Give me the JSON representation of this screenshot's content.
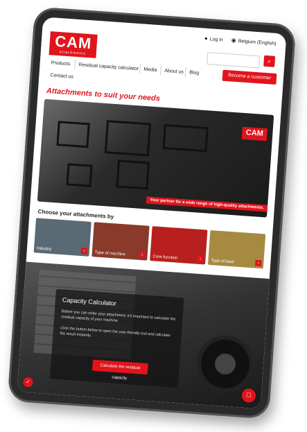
{
  "header": {
    "logo": "CAM",
    "logo_sub": "attachments",
    "login": "Log in",
    "region": "Belgium (English)",
    "search_placeholder": "",
    "nav": [
      "Products",
      "Residual capacity calculator",
      "Media",
      "About us",
      "Blog"
    ],
    "contact": "Contact us",
    "cta": "Become a customer"
  },
  "page_title": "Attachments to suit your needs",
  "hero": {
    "logo": "CAM",
    "tagline": "Your partner for a wide range of high-quality attachments."
  },
  "choose_title": "Choose your attachments by",
  "cards": [
    {
      "label": "Industry",
      "color": "#5a6a74"
    },
    {
      "label": "Type of machine",
      "color": "#8a3a2a"
    },
    {
      "label": "Core function",
      "color": "#b82020"
    },
    {
      "label": "Type of load",
      "color": "#a58a40"
    }
  ],
  "calculator": {
    "title": "Capacity Calculator",
    "p1": "Before you can order your attachment, it's important to calculate the residual capacity of your machine.",
    "p2": "Click the button below to open the user-friendly tool and calculate the result instantly.",
    "button": "Calculate the residual capacity"
  },
  "colors": {
    "accent": "#e1141c"
  }
}
